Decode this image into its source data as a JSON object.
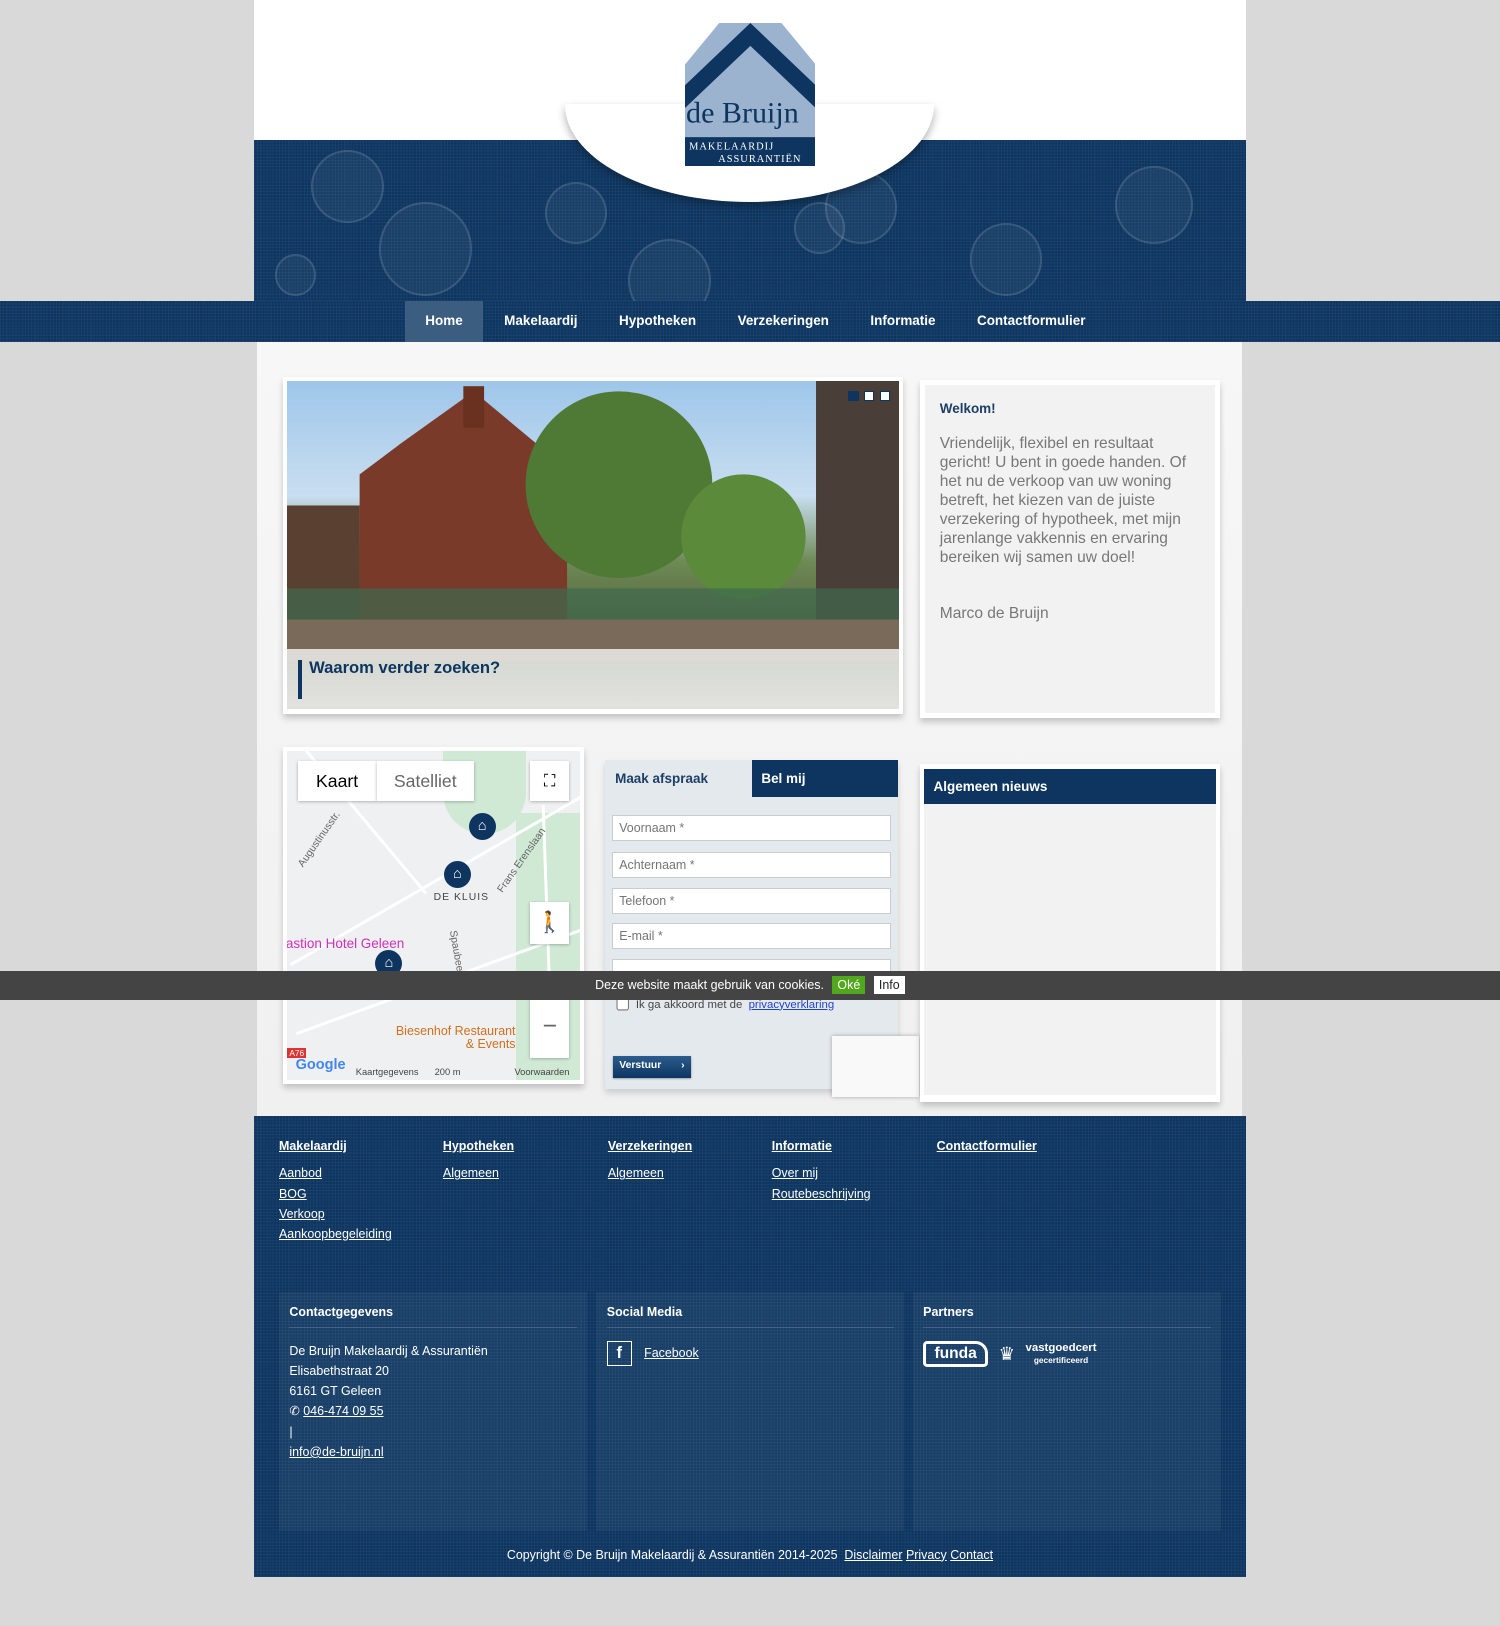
{
  "logo": {
    "name": "de Bruijn",
    "line1": "MAKELAARDIJ",
    "line2": "ASSURANTIËN"
  },
  "nav": [
    {
      "label": "Home",
      "active": true
    },
    {
      "label": "Makelaardij"
    },
    {
      "label": "Hypotheken"
    },
    {
      "label": "Verzekeringen"
    },
    {
      "label": "Informatie"
    },
    {
      "label": "Contactformulier"
    }
  ],
  "slider": {
    "caption": "Waarom verder zoeken?",
    "active_slide": 1,
    "slide_count": 3
  },
  "welcome": {
    "title": "Welkom!",
    "text": "Vriendelijk, flexibel en resultaat gericht! U bent in goede handen. Of het nu de verkoop van uw woning betreft, het kiezen van de juiste verzekering of hypotheek, met mijn jarenlange vakkennis en ervaring bereiken wij samen uw doel!",
    "signature": "Marco de Bruijn"
  },
  "map": {
    "type_map": "Kaart",
    "type_satellite": "Satelliet",
    "labels": [
      "Augustinusstr.",
      "DE KLUIS",
      "Frans Erenslaan",
      "Spaubeek",
      "Bastion Hotel Geleen",
      "Biesenhof Restaurant & Events",
      "A76"
    ],
    "footer_data": "Kaartgegevens",
    "scale": "200 m",
    "terms": "Voorwaarden",
    "logo": "Google"
  },
  "form": {
    "tab_active": "Maak afspraak",
    "tab_other": "Bel mij",
    "placeholders": {
      "first": "Voornaam *",
      "last": "Achternaam *",
      "phone": "Telefoon *",
      "email": "E-mail *"
    },
    "agree_text": "Ik ga akkoord met de",
    "agree_link": "privacyverklaring",
    "submit": "Verstuur"
  },
  "news": {
    "title": "Algemeen nieuws"
  },
  "cookie": {
    "text": "Deze website maakt gebruik van cookies.",
    "ok": "Oké",
    "info": "Info"
  },
  "footer": {
    "columns": [
      {
        "title": "Makelaardij",
        "links": [
          "Aanbod",
          "BOG",
          "Verkoop",
          "Aankoopbegeleiding"
        ]
      },
      {
        "title": "Hypotheken",
        "links": [
          "Algemeen"
        ]
      },
      {
        "title": "Verzekeringen",
        "links": [
          "Algemeen"
        ]
      },
      {
        "title": "Informatie",
        "links": [
          "Over mij",
          "Routebeschrijving"
        ]
      },
      {
        "title": "Contactformulier",
        "links": []
      }
    ],
    "contact": {
      "title": "Contactgegevens",
      "company": "De Bruijn Makelaardij & Assurantiën",
      "street": "Elisabethstraat 20",
      "city": "6161 GT Geleen",
      "phone": "046-474 09 55",
      "separator": "|",
      "email": "info@de-bruijn.nl"
    },
    "social": {
      "title": "Social Media",
      "facebook": "Facebook"
    },
    "partners": {
      "title": "Partners",
      "funda": "funda",
      "vastgoedcert": "vastgoedcert",
      "vastgoedcert_sub": "gecertificeerd"
    },
    "copyright": "Copyright © De Bruijn Makelaardij & Assurantiën 2014-2025",
    "links": [
      "Disclaimer",
      "Privacy",
      "Contact"
    ]
  },
  "colors": {
    "primary": "#0d3560",
    "accent_green": "#52a81c",
    "nav_active": "#3a5d80"
  }
}
